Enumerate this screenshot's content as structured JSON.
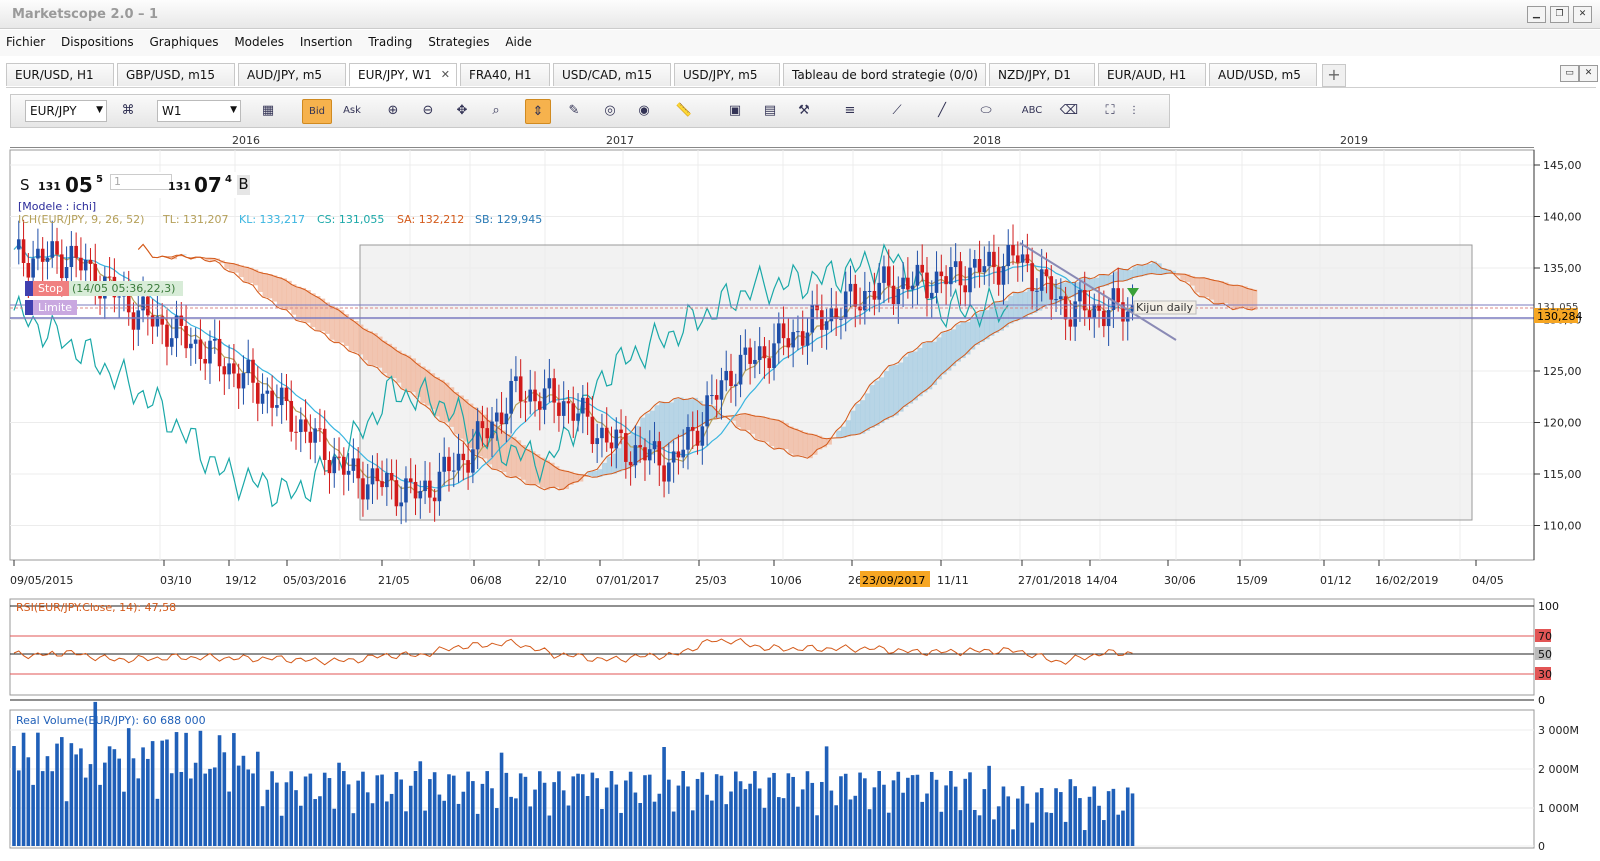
{
  "window": {
    "title": "Marketscope 2.0 – 1"
  },
  "menu": [
    "Fichier",
    "Dispositions",
    "Graphiques",
    "Modeles",
    "Insertion",
    "Trading",
    "Strategies",
    "Aide"
  ],
  "tabs": [
    {
      "label": "EUR/USD, H1",
      "active": false
    },
    {
      "label": "GBP/USD, m15",
      "active": false
    },
    {
      "label": "AUD/JPY, m5",
      "active": false
    },
    {
      "label": "EUR/JPY, W1",
      "active": true
    },
    {
      "label": "FRA40, H1",
      "active": false
    },
    {
      "label": "USD/CAD, m15",
      "active": false
    },
    {
      "label": "USD/JPY, m5",
      "active": false
    },
    {
      "label": "Tableau de bord strategie (0/0)",
      "active": false
    },
    {
      "label": "NZD/JPY, D1",
      "active": false
    },
    {
      "label": "EUR/AUD, H1",
      "active": false
    },
    {
      "label": "AUD/USD, m5",
      "active": false
    }
  ],
  "toolbar": {
    "symbol": "EUR/JPY",
    "timeframe": "W1",
    "bid_label": "Bid",
    "ask_label": "Ask"
  },
  "quote": {
    "sell_label": "S",
    "sell_big": "131",
    "sell_main": "05",
    "sell_sup": "5",
    "amount": "1",
    "buy_big": "131",
    "buy_main": "07",
    "buy_sup": "4",
    "buy_label": "B"
  },
  "labels": {
    "model": "[Modele : ichi]",
    "ichimoku": "ICH(EUR/JPY, 9, 26, 52)",
    "tl": "TL: 131,207",
    "kl": "KL: 133,217",
    "cs": "CS: 131,055",
    "sa": "SA: 132,212",
    "sb": "SB: 129,945",
    "stop": "Stop",
    "stop_info": "(14/05 05:36,22,3)",
    "limit": "Limite",
    "kijun": "Kijun daily",
    "price_now": "130,284",
    "price_ref": "131,055",
    "cursor_date": "23/09/2017",
    "rsi": "RSI(EUR/JPY.Close, 14): 47,58",
    "volume": "Real Volume(EUR/JPY): 60 688 000"
  },
  "years": [
    "2016",
    "2017",
    "2018",
    "2019"
  ],
  "date_ticks": [
    "09/05/2015",
    "03/10",
    "19/12",
    "05/03/2016",
    "21/05",
    "06/08",
    "22/10",
    "07/01/2017",
    "25/03",
    "10/06",
    "26",
    "11/11",
    "27/01/2018",
    "14/04",
    "30/06",
    "15/09",
    "01/12",
    "16/02/2019",
    "04/05"
  ],
  "price_ticks": [
    "145,00",
    "140,00",
    "135,00",
    "130,00",
    "125,00",
    "120,00",
    "115,00",
    "110,00"
  ],
  "rsi_ticks": [
    "100",
    "70",
    "50",
    "30",
    "0"
  ],
  "vol_ticks": [
    "3 000M",
    "2 000M",
    "1 000M",
    "0"
  ],
  "colors": {
    "bull": "#1f4fa8",
    "bear": "#d11a1a",
    "tenkan": "#b5a05a",
    "kijun": "#39b5e0",
    "chikou": "#1aa8a8",
    "cloud_bear": "#f0b9a0",
    "cloud_bull": "#a9cde2",
    "rsi": "#d45a1a",
    "vol": "#1f5fb8",
    "accent": "#f6a623"
  }
}
